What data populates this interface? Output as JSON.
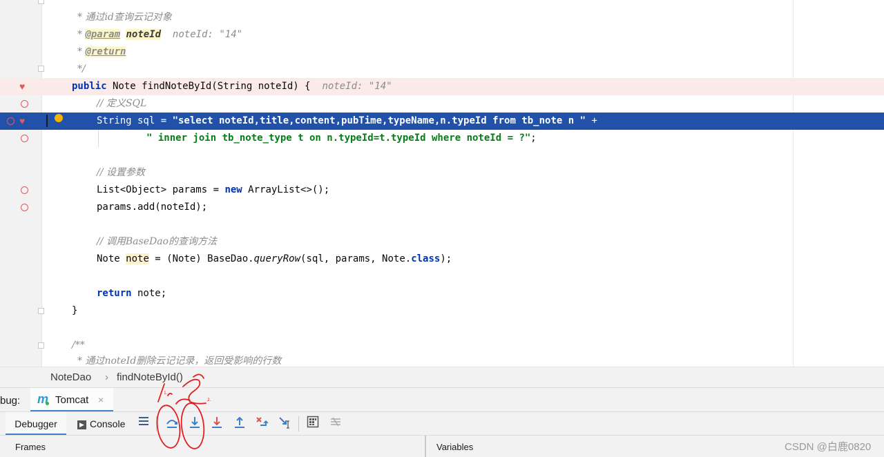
{
  "editor": {
    "lines": [
      {
        "type": "doc",
        "parts": [
          {
            "t": "* ",
            "c": "cmt"
          },
          {
            "t": "通过id查询云记对象",
            "c": "cmt"
          }
        ]
      },
      {
        "type": "doc",
        "parts": [
          {
            "t": "* ",
            "c": "cmt"
          },
          {
            "t": "@param",
            "c": "doctag"
          },
          {
            "t": " ",
            "c": ""
          },
          {
            "t": "noteId",
            "c": "docparam"
          },
          {
            "t": "  noteId: \"14\"",
            "c": "inlay"
          }
        ]
      },
      {
        "type": "doc",
        "parts": [
          {
            "t": "* ",
            "c": "cmt"
          },
          {
            "t": "@return",
            "c": "doctag"
          }
        ]
      },
      {
        "type": "doc",
        "parts": [
          {
            "t": "*/",
            "c": "cmt"
          }
        ]
      }
    ],
    "comment_title": "* 通过id查询云记对象",
    "param_tag": "@param",
    "param_name": "noteId",
    "param_inlay": "noteId: \"14\"",
    "return_tag": "@return",
    "doc_end": "*/",
    "sig_public": "public",
    "sig_rest": " Note findNoteById(String noteId) {",
    "sig_inlay": "noteId: \"14\"",
    "cmt_sql": "// 定义SQL",
    "sql_decl": "String sql = ",
    "sql_str1": "\"select noteId,title,content,pubTime,typeName,n.typeId from tb_note n \"",
    "sql_plus": " +",
    "sql_str2": "\" inner join tb_note_type t on n.typeId=t.typeId where noteId = ?\"",
    "sql_semi": ";",
    "cmt_params": "// 设置参数",
    "params_decl": "List<Object> params = ",
    "kw_new": "new",
    "params_rest": " ArrayList<>();",
    "params_add": "params.add(noteId);",
    "cmt_query": "// 调用BaseDao的查询方法",
    "note_type": "Note ",
    "note_var": "note",
    "note_rest1": " = (Note) BaseDao.",
    "note_query": "queryRow",
    "note_rest2": "(sql, params, Note.",
    "kw_class": "class",
    "note_rest3": ");",
    "kw_return": "return",
    "return_rest": " note;",
    "close_brace": "}",
    "doc2_start": "/**",
    "doc2_line": "* 通过noteId删除云记记录，返回受影响的行数"
  },
  "breadcrumb": {
    "class_name": "NoteDao",
    "separator": "›",
    "method_name": "findNoteById()"
  },
  "debug_bar": {
    "label": "bug:",
    "tab_label": "Tomcat",
    "close": "×"
  },
  "toolbar": {
    "debugger_label": "Debugger",
    "console_label": "Console"
  },
  "panels": {
    "frames_label": "Frames",
    "variables_label": "Variables"
  },
  "watermark": "CSDN @白鹿0820",
  "annotation": {
    "mark1": "1.",
    "mark2": "2."
  },
  "colors": {
    "selection": "#2151a8",
    "breakpoint": "#db5c5c",
    "keyword": "#0033b3",
    "string": "#067d17",
    "annotation_pen": "#e02020"
  }
}
